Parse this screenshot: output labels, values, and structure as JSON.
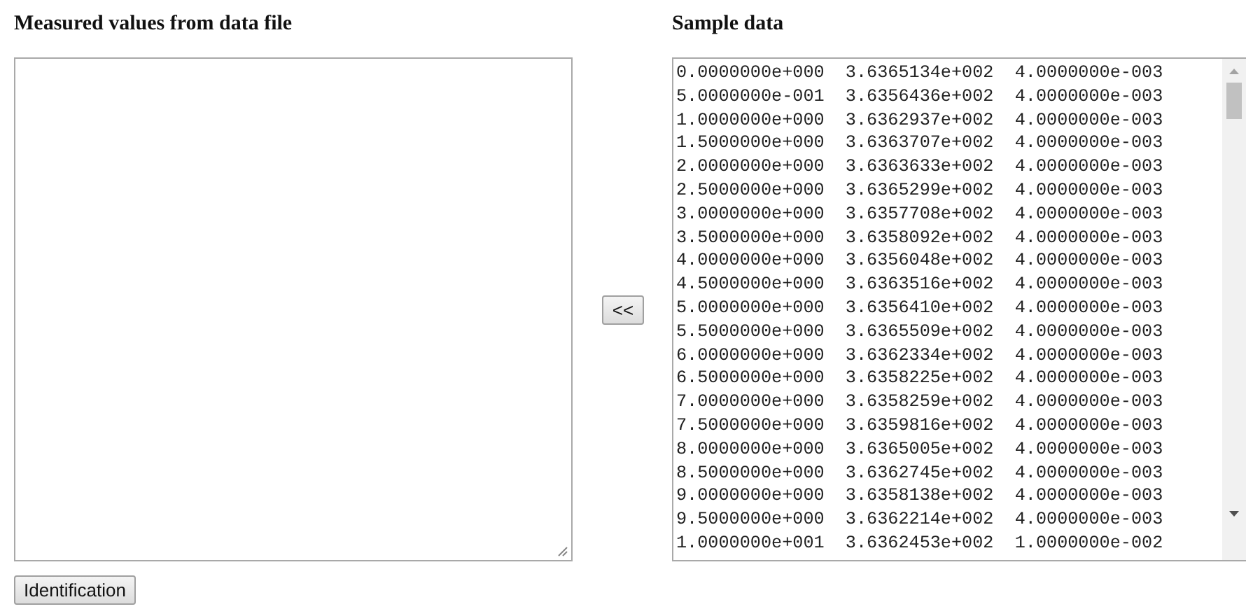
{
  "measured": {
    "heading": "Measured values from data file"
  },
  "copy_button": {
    "label": "<<"
  },
  "sample": {
    "heading": "Sample data",
    "lines": [
      "0.0000000e+000  3.6365134e+002  4.0000000e-003",
      "5.0000000e-001  3.6356436e+002  4.0000000e-003",
      "1.0000000e+000  3.6362937e+002  4.0000000e-003",
      "1.5000000e+000  3.6363707e+002  4.0000000e-003",
      "2.0000000e+000  3.6363633e+002  4.0000000e-003",
      "2.5000000e+000  3.6365299e+002  4.0000000e-003",
      "3.0000000e+000  3.6357708e+002  4.0000000e-003",
      "3.5000000e+000  3.6358092e+002  4.0000000e-003",
      "4.0000000e+000  3.6356048e+002  4.0000000e-003",
      "4.5000000e+000  3.6363516e+002  4.0000000e-003",
      "5.0000000e+000  3.6356410e+002  4.0000000e-003",
      "5.5000000e+000  3.6365509e+002  4.0000000e-003",
      "6.0000000e+000  3.6362334e+002  4.0000000e-003",
      "6.5000000e+000  3.6358225e+002  4.0000000e-003",
      "7.0000000e+000  3.6358259e+002  4.0000000e-003",
      "7.5000000e+000  3.6359816e+002  4.0000000e-003",
      "8.0000000e+000  3.6365005e+002  4.0000000e-003",
      "8.5000000e+000  3.6362745e+002  4.0000000e-003",
      "9.0000000e+000  3.6358138e+002  4.0000000e-003",
      "9.5000000e+000  3.6362214e+002  4.0000000e-003",
      "1.0000000e+001  3.6362453e+002  1.0000000e-002"
    ]
  },
  "identify_button": {
    "label": "Identification"
  }
}
